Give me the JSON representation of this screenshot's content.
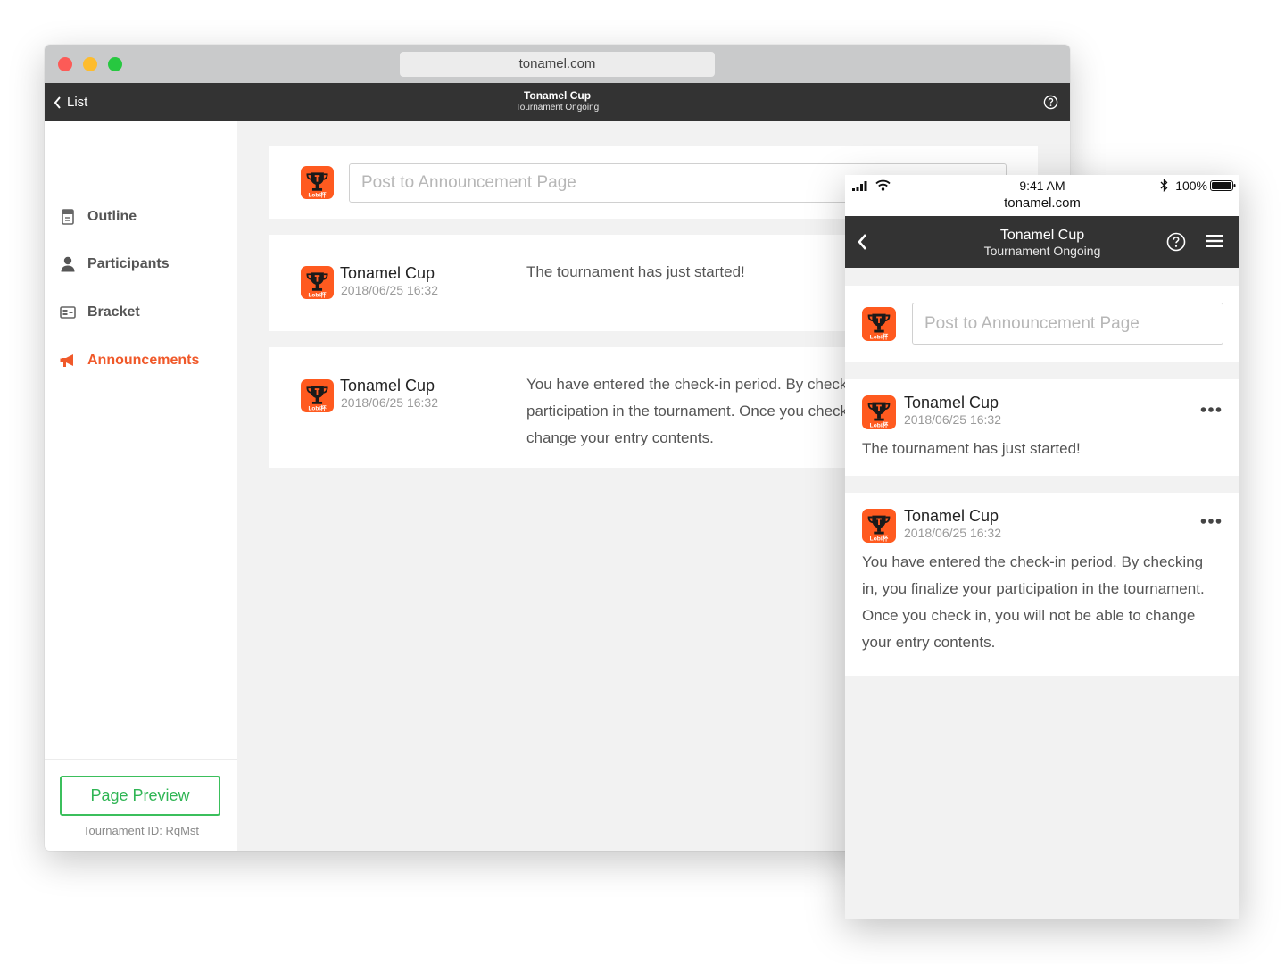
{
  "desktop": {
    "url": "tonamel.com",
    "appbar": {
      "back_label": "List",
      "title": "Tonamel Cup",
      "subtitle": "Tournament Ongoing"
    },
    "sidebar": {
      "items": [
        {
          "label": "Outline",
          "icon": "document-icon"
        },
        {
          "label": "Participants",
          "icon": "person-icon"
        },
        {
          "label": "Bracket",
          "icon": "bracket-icon"
        },
        {
          "label": "Announcements",
          "icon": "megaphone-icon",
          "active": true
        }
      ],
      "preview_label": "Page Preview",
      "tournament_id": "Tournament ID: RqMst"
    },
    "post": {
      "placeholder": "Post to Announcement Page"
    },
    "announcements": [
      {
        "name": "Tonamel Cup",
        "date": "2018/06/25 16:32",
        "text": "The tournament has just started!"
      },
      {
        "name": "Tonamel Cup",
        "date": "2018/06/25 16:32",
        "text": "You have entered the check-in period. By checking in, you finalize your participation in the tournament. Once you check in, you will not be able to change your entry contents."
      }
    ]
  },
  "mobile": {
    "status": {
      "time": "9:41 AM",
      "url": "tonamel.com",
      "battery": "100%"
    },
    "appbar": {
      "title": "Tonamel Cup",
      "subtitle": "Tournament Ongoing"
    },
    "post": {
      "placeholder": "Post to Announcement Page"
    },
    "announcements": [
      {
        "name": "Tonamel Cup",
        "date": "2018/06/25 16:32",
        "text": "The tournament has just started!"
      },
      {
        "name": "Tonamel Cup",
        "date": "2018/06/25 16:32",
        "text": "You have entered the check-in period. By checking in, you finalize your participation in the tournament. Once you check in, you will not be able to change your entry contents."
      }
    ]
  },
  "colors": {
    "accent": "#f0592a",
    "preview_green": "#2fb554",
    "appbar": "#333333",
    "logo_orange": "#ff5a1f"
  },
  "logo_text": "Lobi杯"
}
